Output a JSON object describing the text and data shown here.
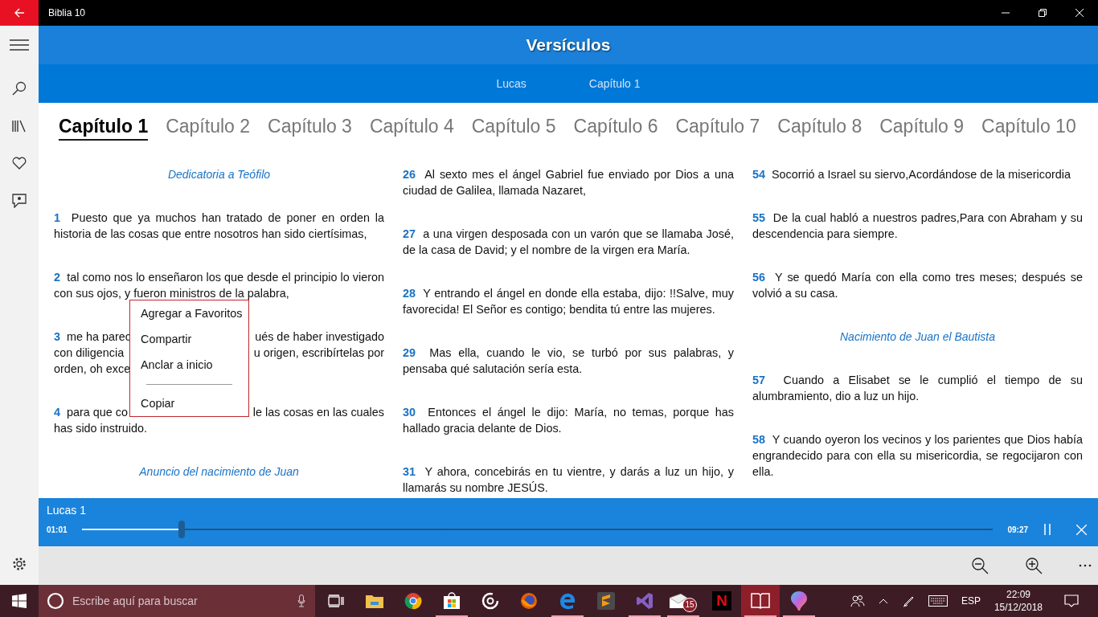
{
  "window": {
    "title": "Biblia 10"
  },
  "header": {
    "title": "Versículos",
    "breadcrumbs": [
      "Lucas",
      "Capítulo 1"
    ]
  },
  "chapter_tabs": [
    {
      "label": "Capítulo 1",
      "selected": true
    },
    {
      "label": "Capítulo 2",
      "selected": false
    },
    {
      "label": "Capítulo 3",
      "selected": false
    },
    {
      "label": "Capítulo 4",
      "selected": false
    },
    {
      "label": "Capítulo 5",
      "selected": false
    },
    {
      "label": "Capítulo 6",
      "selected": false
    },
    {
      "label": "Capítulo 7",
      "selected": false
    },
    {
      "label": "Capítulo 8",
      "selected": false
    },
    {
      "label": "Capítulo 9",
      "selected": false
    },
    {
      "label": "Capítulo 10",
      "selected": false
    }
  ],
  "columns": [
    [
      {
        "kind": "heading",
        "text": "Dedicatoria a Teófilo"
      },
      {
        "kind": "verse",
        "number": "1",
        "text": "Puesto que ya muchos han tratado de poner en orden la historia de las cosas que entre nosotros han sido ciertísimas,"
      },
      {
        "kind": "verse",
        "number": "2",
        "text": "tal como nos lo enseñaron los que desde el principio lo vieron con sus ojos, y fueron ministros de la palabra,"
      },
      {
        "kind": "covered",
        "number": "3",
        "lines": [
          {
            "left": "me ha parec",
            "right": "ués de haber investigado"
          },
          {
            "left": "con diligencia",
            "right": "u origen, escribírtelas por"
          },
          {
            "left": "orden, oh exce"
          }
        ]
      },
      {
        "kind": "covered",
        "number": "4",
        "lines": [
          {
            "left": "para que co",
            "right": "le las cosas en las cuales"
          },
          {
            "left": "has sido instruido."
          }
        ]
      },
      {
        "kind": "heading",
        "text": "Anuncio del nacimiento de Juan"
      }
    ],
    [
      {
        "kind": "verse",
        "number": "26",
        "text": "Al sexto mes el ángel Gabriel fue enviado por Dios a una ciudad de Galilea, llamada Nazaret,"
      },
      {
        "kind": "verse",
        "number": "27",
        "text": "a una virgen desposada con un varón que se llamaba José, de la casa de David; y el nombre de la virgen era María."
      },
      {
        "kind": "verse",
        "number": "28",
        "text": "Y entrando el ángel en donde ella estaba, dijo: !!Salve, muy favorecida! El Señor es contigo; bendita tú entre las mujeres."
      },
      {
        "kind": "verse",
        "number": "29",
        "text": "Mas ella, cuando le vio, se turbó por sus palabras, y pensaba qué salutación sería esta."
      },
      {
        "kind": "verse",
        "number": "30",
        "text": "Entonces el ángel le dijo: María, no temas, porque has hallado gracia delante de Dios."
      },
      {
        "kind": "verse",
        "number": "31",
        "text": "Y ahora, concebirás en tu vientre, y darás a luz un hijo, y llamarás su nombre JESÚS."
      }
    ],
    [
      {
        "kind": "verse",
        "number": "54",
        "text": "Socorrió a Israel su siervo,Acordándose de la misericordia"
      },
      {
        "kind": "verse",
        "number": "55",
        "text": "De la cual habló a nuestros padres,Para con Abraham y su descendencia para siempre."
      },
      {
        "kind": "verse",
        "number": "56",
        "text": "Y se quedó María con ella como tres meses; después se volvió a su casa."
      },
      {
        "kind": "heading",
        "text": "Nacimiento de Juan el Bautista"
      },
      {
        "kind": "verse",
        "number": "57",
        "text": "Cuando a Elisabet se le cumplió el tiempo de su alumbramiento, dio a luz un hijo."
      },
      {
        "kind": "verse",
        "number": "58",
        "text": "Y cuando oyeron los vecinos y los parientes que Dios había engrandecido para con ella su misericordia, se regocijaron con ella."
      }
    ]
  ],
  "context_menu": {
    "items": [
      {
        "kind": "item",
        "label": "Agregar a Favoritos"
      },
      {
        "kind": "item",
        "label": "Compartir"
      },
      {
        "kind": "item",
        "label": "Anclar a inicio"
      },
      {
        "kind": "separator"
      },
      {
        "kind": "item",
        "label": "Copiar"
      }
    ]
  },
  "player": {
    "title": "Lucas 1",
    "elapsed": "01:01",
    "level": 0.11,
    "total": "09:27"
  },
  "taskbar": {
    "search_placeholder": "Escribe aquí para buscar",
    "apps": [
      {
        "kind": "taskview",
        "running": false
      },
      {
        "kind": "folder",
        "running": false
      },
      {
        "kind": "chrome",
        "running": false
      },
      {
        "kind": "store",
        "running": true
      },
      {
        "kind": "music",
        "running": false
      },
      {
        "kind": "firefox",
        "running": false
      },
      {
        "kind": "edge",
        "running": true
      },
      {
        "kind": "sublime",
        "running": false
      },
      {
        "kind": "vs",
        "running": true
      },
      {
        "kind": "mail",
        "badge": "15",
        "running": true
      },
      {
        "kind": "tile",
        "label": "N",
        "running": false
      },
      {
        "kind": "book",
        "running": true,
        "selected": true
      },
      {
        "kind": "paint",
        "running": true
      }
    ],
    "language": "ESP",
    "time": "22:09",
    "date": "15/12/2018"
  }
}
